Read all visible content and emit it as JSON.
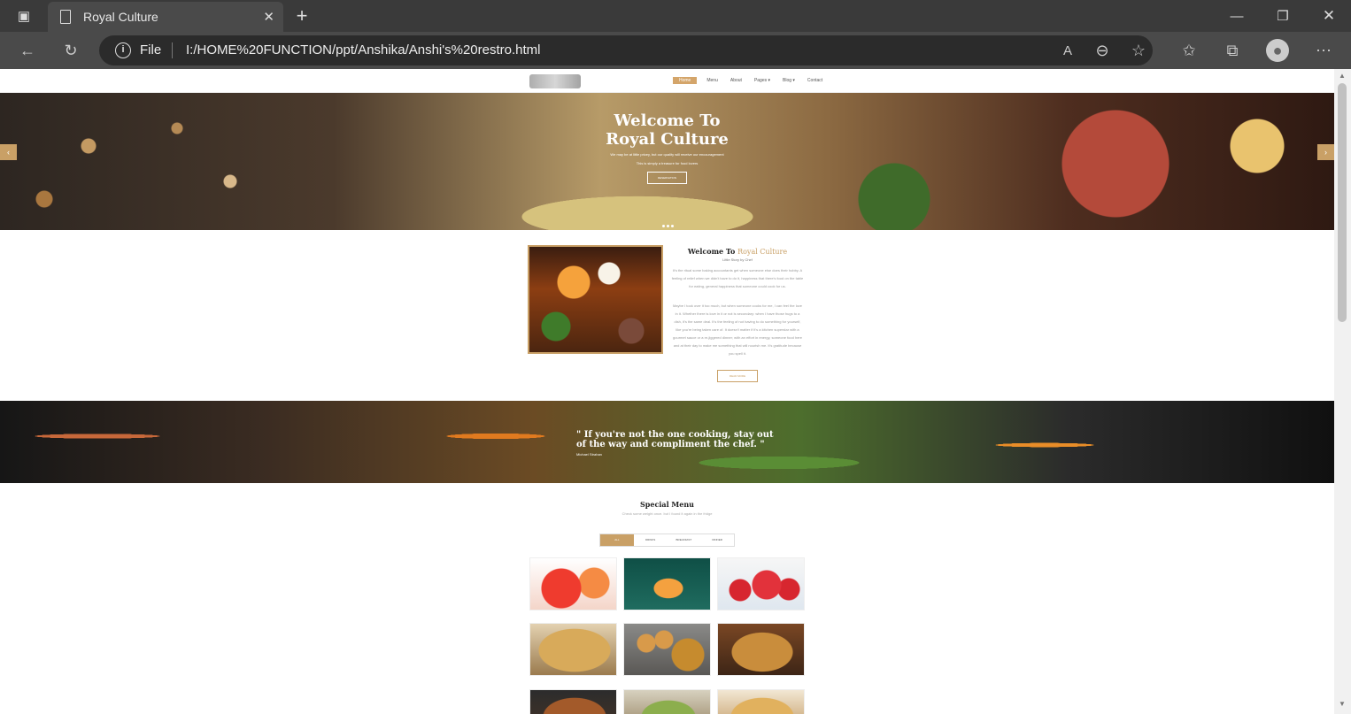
{
  "browser": {
    "tab_title": "Royal Culture",
    "new_tab": "+",
    "address_file_label": "File",
    "address_url": "I:/HOME%20FUNCTION/ppt/Anshika/Anshi's%20restro.html"
  },
  "site": {
    "nav": [
      "Home",
      "Menu",
      "About",
      "Pages ▾",
      "Blog ▾",
      "Contact"
    ],
    "hero": {
      "title_line1": "Welcome To",
      "title_line2": "Royal Culture",
      "subtitle1": "We may be at little pricey, but our quality will receive our encouragement",
      "subtitle2": "This is simply a treasure for food lovers",
      "button": "RESERVATION"
    },
    "about": {
      "title_main": "Welcome To ",
      "title_gold": "Royal Culture",
      "subtitle": "Little Story by Chef",
      "para1": "It's the ritual some baking accountants get when someone else does their hobby. A feeling of relief when we didn't have to do it, happiness that there's food on the table for eating, general happiness that someone could cook for us.",
      "para2": "Maybe I took over it too much, but when someone cooks for me, I can feel the love in it. Whether there is love in it or not is secondary: when I have those hugs to a dish, it's the same deal. It's the feeling of not having to do something for yourself, like you're being taken care of. It doesn't matter if it's a kitchen superstar with a gourmet sauce or a re-jiggered dinner; with an effort in energy, someone food here and at their day to make me something that will nourish me. It's gratitude because you spell it.",
      "button": "READ MORE"
    },
    "quote": {
      "line1": "\" If you're not the one cooking, stay out",
      "line2": "of the way and compliment the chef. \"",
      "author": "Michael Strahan"
    },
    "special_menu": {
      "title": "Special Menu",
      "subtitle": "Check some weight once. but I found it again in the fridge",
      "tabs": [
        "ALL",
        "DRINKS",
        "BREAKFAST",
        "DINNER"
      ]
    }
  }
}
